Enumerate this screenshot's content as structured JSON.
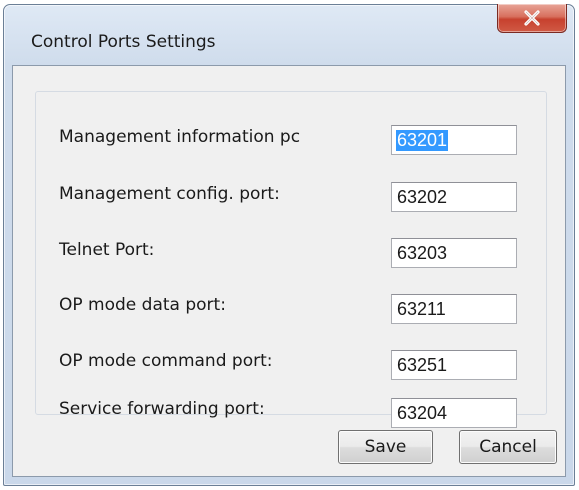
{
  "window": {
    "title": "Control Ports Settings"
  },
  "ports": [
    {
      "label": "Management information pc",
      "value": "63201"
    },
    {
      "label": "Management config. port:",
      "value": "63202"
    },
    {
      "label": "Telnet Port:",
      "value": "63203"
    },
    {
      "label": "OP mode data port:",
      "value": "63211"
    },
    {
      "label": "OP mode command port:",
      "value": "63251"
    },
    {
      "label": "Service forwarding port:",
      "value": "63204"
    }
  ],
  "buttons": {
    "save_label": "Save",
    "cancel_label": "Cancel"
  },
  "icons": {
    "close": "close-icon"
  },
  "colors": {
    "selection": "#3399ff",
    "close_button": "#c7412e"
  }
}
